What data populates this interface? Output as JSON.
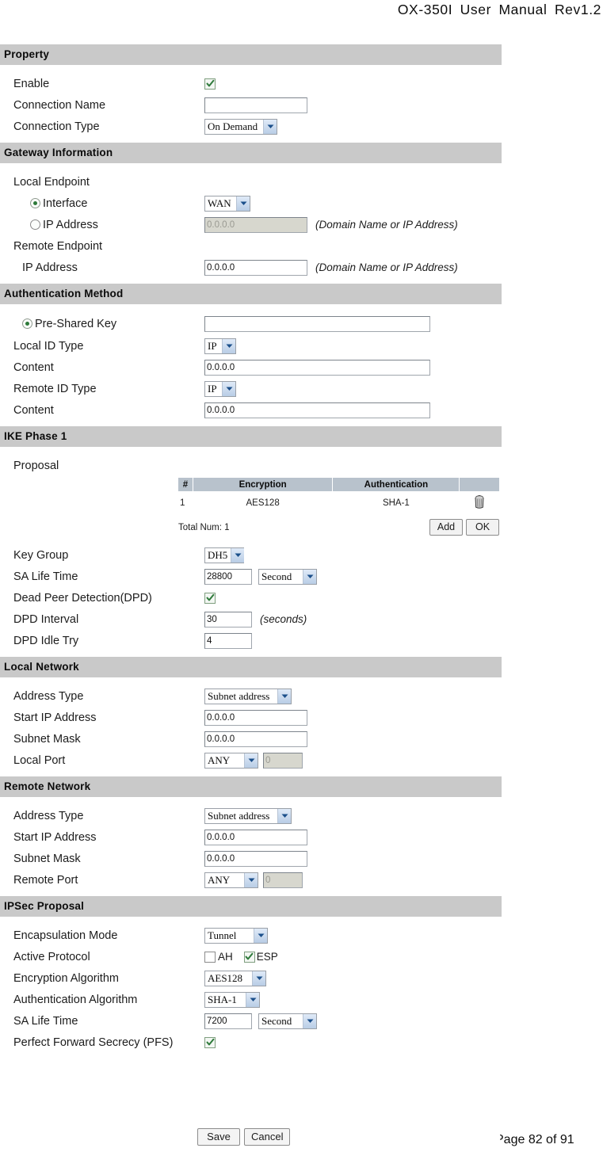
{
  "document": {
    "header": "OX-350I  User  Manual  Rev1.2",
    "footer": "Page 82 of 91"
  },
  "sections": {
    "property": {
      "title": "Property",
      "enable_label": "Enable",
      "enable_checked": true,
      "connection_name_label": "Connection Name",
      "connection_name_value": "",
      "connection_type_label": "Connection Type",
      "connection_type_value": "On Demand"
    },
    "gateway": {
      "title": "Gateway Information",
      "local_endpoint_label": "Local Endpoint",
      "interface_label": "Interface",
      "interface_selected": true,
      "interface_value": "WAN",
      "ip_address_radio_label": "IP Address",
      "ip_address_radio_selected": false,
      "local_ip_value": "0.0.0.0",
      "local_ip_note": "(Domain Name or IP Address)",
      "remote_endpoint_label": "Remote Endpoint",
      "remote_ip_label": "IP Address",
      "remote_ip_value": "0.0.0.0",
      "remote_ip_note": "(Domain Name or IP Address)"
    },
    "auth": {
      "title": "Authentication Method",
      "psk_label": "Pre-Shared Key",
      "psk_selected": true,
      "psk_value": "",
      "local_id_type_label": "Local ID Type",
      "local_id_type_value": "IP",
      "local_content_label": "Content",
      "local_content_value": "0.0.0.0",
      "remote_id_type_label": "Remote ID Type",
      "remote_id_type_value": "IP",
      "remote_content_label": "Content",
      "remote_content_value": "0.0.0.0"
    },
    "ike": {
      "title": "IKE Phase 1",
      "proposal_label": "Proposal",
      "table": {
        "headers": [
          "#",
          "Encryption",
          "Authentication",
          ""
        ],
        "rows": [
          {
            "num": "1",
            "encryption": "AES128",
            "authentication": "SHA-1"
          }
        ]
      },
      "total_num": "Total Num: 1",
      "add_label": "Add",
      "ok_label": "OK",
      "key_group_label": "Key Group",
      "key_group_value": "DH5",
      "sa_life_time_label": "SA Life Time",
      "sa_life_time_value": "28800",
      "sa_life_time_unit": "Second",
      "dpd_label": "Dead Peer Detection(DPD)",
      "dpd_checked": true,
      "dpd_interval_label": "DPD Interval",
      "dpd_interval_value": "30",
      "dpd_interval_note": "(seconds)",
      "dpd_idle_try_label": "DPD Idle Try",
      "dpd_idle_try_value": "4"
    },
    "local_network": {
      "title": "Local Network",
      "address_type_label": "Address Type",
      "address_type_value": "Subnet address",
      "start_ip_label": "Start IP Address",
      "start_ip_value": "0.0.0.0",
      "subnet_mask_label": "Subnet Mask",
      "subnet_mask_value": "0.0.0.0",
      "port_label": "Local Port",
      "port_mode_value": "ANY",
      "port_value": "0"
    },
    "remote_network": {
      "title": "Remote Network",
      "address_type_label": "Address Type",
      "address_type_value": "Subnet address",
      "start_ip_label": "Start IP Address",
      "start_ip_value": "0.0.0.0",
      "subnet_mask_label": "Subnet Mask",
      "subnet_mask_value": "0.0.0.0",
      "port_label": "Remote Port",
      "port_mode_value": "ANY",
      "port_value": "0"
    },
    "ipsec": {
      "title": "IPSec Proposal",
      "encapsulation_label": "Encapsulation Mode",
      "encapsulation_value": "Tunnel",
      "active_protocol_label": "Active Protocol",
      "ah_label": "AH",
      "ah_checked": false,
      "esp_label": "ESP",
      "esp_checked": true,
      "encryption_algorithm_label": "Encryption Algorithm",
      "encryption_algorithm_value": "AES128",
      "authentication_algorithm_label": "Authentication Algorithm",
      "authentication_algorithm_value": "SHA-1",
      "sa_life_time_label": "SA Life Time",
      "sa_life_time_value": "7200",
      "sa_life_time_unit": "Second",
      "pfs_label": "Perfect Forward Secrecy (PFS)",
      "pfs_checked": true
    }
  },
  "form_actions": {
    "save_label": "Save",
    "cancel_label": "Cancel"
  },
  "colors": {
    "section_bar": "#c9c9c9",
    "table_header": "#b8c2cc",
    "check_green": "#2e7a3a",
    "select_arrow": "#b9cde6"
  }
}
